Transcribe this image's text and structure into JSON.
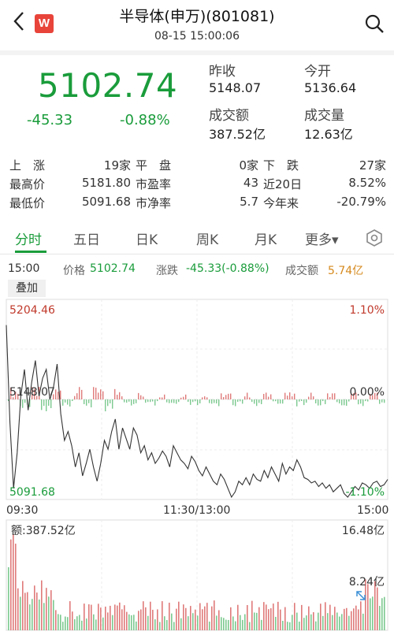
{
  "header": {
    "title": "半导体(申万)(801081)",
    "datetime": "08-15 15:00:06",
    "logo_letter": "W"
  },
  "quote": {
    "price": "5102.74",
    "change": "-45.33",
    "change_pct": "-0.88%",
    "prev_close_label": "昨收",
    "prev_close": "5148.07",
    "open_label": "今开",
    "open": "5136.64",
    "turnover_label": "成交额",
    "turnover": "387.52亿",
    "volume_label": "成交量",
    "volume": "12.63亿"
  },
  "stats": {
    "rows": [
      [
        "上　涨",
        "19家",
        "平　盘",
        "0家",
        "下　跌",
        "27家"
      ],
      [
        "最高价",
        "5181.80",
        "市盈率",
        "43",
        "近20日",
        "8.52%"
      ],
      [
        "最低价",
        "5091.68",
        "市净率",
        "5.7",
        "今年来",
        "-20.79%"
      ]
    ]
  },
  "tabs": [
    "分时",
    "五日",
    "日K",
    "周K",
    "月K",
    "更多▾"
  ],
  "info_bar": {
    "time": "15:00",
    "price_label": "价格",
    "price": "5102.74",
    "change_label": "涨跌",
    "change": "-45.33(-0.88%)",
    "turnover_label": "成交额",
    "turnover": "5.74亿"
  },
  "overlay_label": "叠加",
  "chart_data": {
    "type": "line",
    "y_top_label": "5204.46",
    "y_mid_label": "5148.07",
    "y_bottom_label": "5091.68",
    "pct_top_label": "1.10%",
    "pct_mid_label": "0.00%",
    "pct_bottom_label": "-1.10%",
    "x_labels": [
      "09:30",
      "11:30/13:00",
      "15:00"
    ],
    "ylim": [
      5091.68,
      5204.46
    ],
    "series": [
      {
        "values": [
          5190,
          5135,
          5098,
          5118,
          5150,
          5165,
          5142,
          5158,
          5170,
          5150,
          5160,
          5165,
          5148,
          5155,
          5168,
          5140,
          5125,
          5130,
          5122,
          5110,
          5118,
          5105,
          5112,
          5120,
          5110,
          5102,
          5112,
          5125,
          5120,
          5130,
          5137,
          5120,
          5132,
          5126,
          5120,
          5132,
          5128,
          5118,
          5122,
          5114,
          5118,
          5112,
          5115,
          5119,
          5116,
          5110,
          5122,
          5118,
          5114,
          5112,
          5109,
          5116,
          5113,
          5108,
          5105,
          5110,
          5106,
          5102,
          5100,
          5106,
          5103,
          5098,
          5093,
          5096,
          5102,
          5100,
          5104,
          5100,
          5106,
          5103,
          5102,
          5108,
          5104,
          5110,
          5106,
          5102,
          5112,
          5106,
          5110,
          5108,
          5114,
          5110,
          5104,
          5103,
          5101,
          5102,
          5099,
          5101,
          5098,
          5100,
          5096,
          5098,
          5100,
          5095,
          5093,
          5096,
          5099,
          5097,
          5101,
          5100,
          5098,
          5101,
          5102,
          5099,
          5100,
          5103
        ]
      }
    ]
  },
  "volume_chart": {
    "total_label": "额:387.52亿",
    "max_label": "16.48亿",
    "mid_label": "8.24亿"
  }
}
